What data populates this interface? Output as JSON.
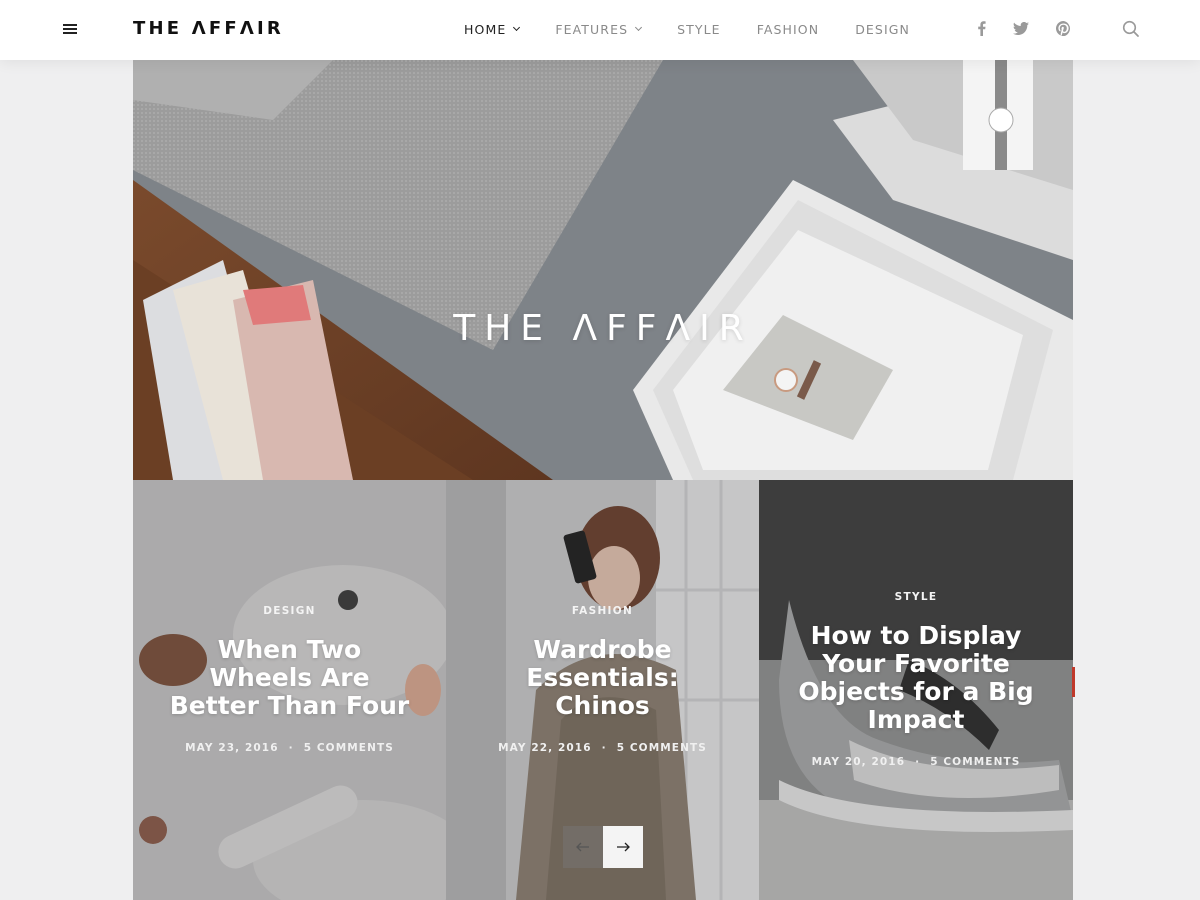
{
  "header": {
    "logo": "THE ΛFFΛIR",
    "nav": [
      {
        "label": "HOME",
        "active": true,
        "dropdown": true
      },
      {
        "label": "FEATURES",
        "active": false,
        "dropdown": true
      },
      {
        "label": "STYLE",
        "active": false,
        "dropdown": false
      },
      {
        "label": "FASHION",
        "active": false,
        "dropdown": false
      },
      {
        "label": "DESIGN",
        "active": false,
        "dropdown": false
      }
    ],
    "social": [
      "facebook-icon",
      "twitter-icon",
      "pinterest-icon"
    ],
    "search_icon": "search-icon",
    "menu_icon": "menu-icon"
  },
  "hero": {
    "title": "THE ΛFFΛIR"
  },
  "posts": [
    {
      "category": "DESIGN",
      "title": "When Two Wheels Are Better Than Four",
      "date": "MAY 23, 2016",
      "comments": "5 COMMENTS"
    },
    {
      "category": "FASHION",
      "title": "Wardrobe Essentials: Chinos",
      "date": "MAY 22, 2016",
      "comments": "5 COMMENTS"
    },
    {
      "category": "STYLE",
      "title": "How to Display Your Favorite Objects for a Big Impact",
      "date": "MAY 20, 2016",
      "comments": "5 COMMENTS"
    }
  ],
  "slider": {
    "prev_icon": "arrow-left-icon",
    "next_icon": "arrow-right-icon"
  },
  "colors": {
    "background": "#efeff0",
    "header_bg": "#ffffff",
    "text_dark": "#222222",
    "nav_muted": "#8a8a8a",
    "accent_red": "#c0392b"
  }
}
